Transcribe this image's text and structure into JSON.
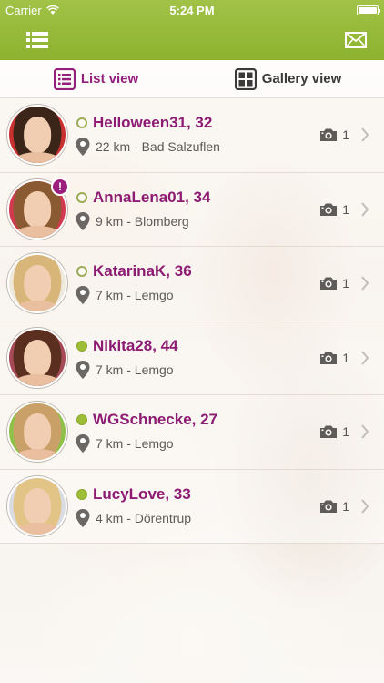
{
  "status_bar": {
    "carrier": "Carrier",
    "time": "5:24 PM"
  },
  "nav": {
    "menu_icon": "list-menu-icon",
    "mail_icon": "envelope-icon"
  },
  "tabs": {
    "list_view": "List view",
    "gallery_view": "Gallery view"
  },
  "colors": {
    "header": "#96b83a",
    "accent": "#8d1b73",
    "online": "#9ebd36"
  },
  "profiles": [
    {
      "name": "Helloween31, 32",
      "location": "22 km - Bad Salzuflen",
      "photos": "1",
      "status": "offline",
      "notification": "",
      "hair": "#3b2418",
      "bg": "#c8312f"
    },
    {
      "name": "AnnaLena01, 34",
      "location": "9 km - Blomberg",
      "photos": "1",
      "status": "offline",
      "notification": "!",
      "hair": "#8a5a32",
      "bg": "#d13a4e"
    },
    {
      "name": "KatarinaK, 36",
      "location": "7 km - Lemgo",
      "photos": "1",
      "status": "offline",
      "notification": "",
      "hair": "#d8b679",
      "bg": "#efe8dc"
    },
    {
      "name": "Nikita28, 44",
      "location": "7 km - Lemgo",
      "photos": "1",
      "status": "online",
      "notification": "",
      "hair": "#5a2f1f",
      "bg": "#a64a58"
    },
    {
      "name": "WGSchnecke, 27",
      "location": "7 km - Lemgo",
      "photos": "1",
      "status": "online",
      "notification": "",
      "hair": "#c9a067",
      "bg": "#8fc04a"
    },
    {
      "name": "LucyLove, 33",
      "location": "4 km - Dörentrup",
      "photos": "1",
      "status": "online",
      "notification": "",
      "hair": "#e2c486",
      "bg": "#d9dde2"
    }
  ]
}
